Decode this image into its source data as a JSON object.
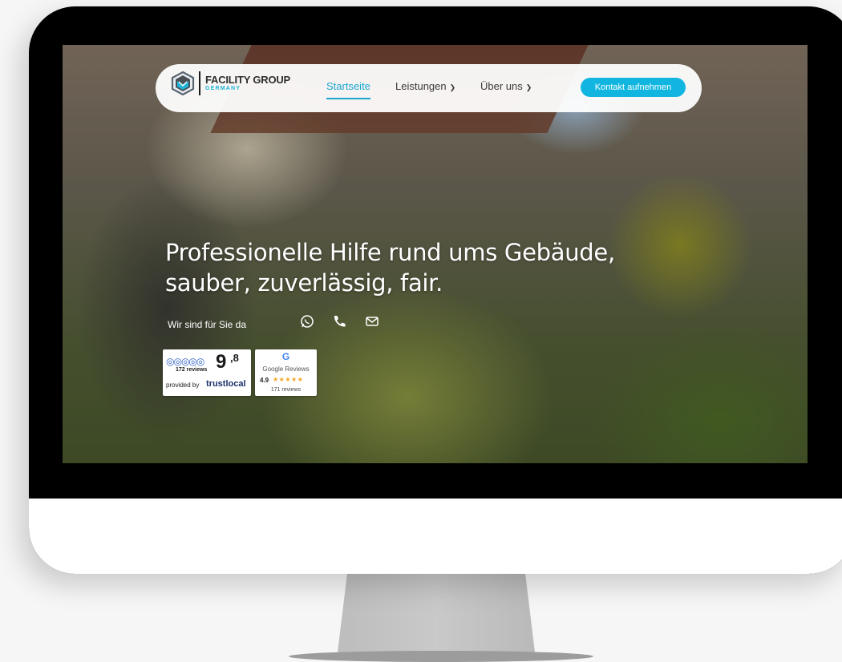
{
  "brand": {
    "name": "FACILITY GROUP",
    "subtitle": "GERMANY",
    "accent_color": "#11b6e0",
    "logo_icon": "cube-logo-icon"
  },
  "nav": {
    "items": [
      {
        "label": "Startseite",
        "active": true
      },
      {
        "label": "Leistungen",
        "dropdown": true
      },
      {
        "label": "Über uns",
        "dropdown": true
      }
    ],
    "cta_label": "Kontakt aufnehmen"
  },
  "hero": {
    "title_line1": "Professionelle Hilfe rund ums Gebäude,",
    "title_line2": "sauber, zuverlässig, fair.",
    "subtitle": "Wir sind für Sie da",
    "contact_icons": [
      "whatsapp-icon",
      "phone-icon",
      "mail-icon"
    ]
  },
  "badges": {
    "trustlocal": {
      "score": "9",
      "score_decimal": ",8",
      "reviews": "172 reviews",
      "provided_by": "provided by",
      "brand": "trustlocal"
    },
    "google": {
      "logo": "G",
      "title": "Google Reviews",
      "rating": "4.9",
      "stars": "★★★★★",
      "count": "171 reviews"
    }
  }
}
